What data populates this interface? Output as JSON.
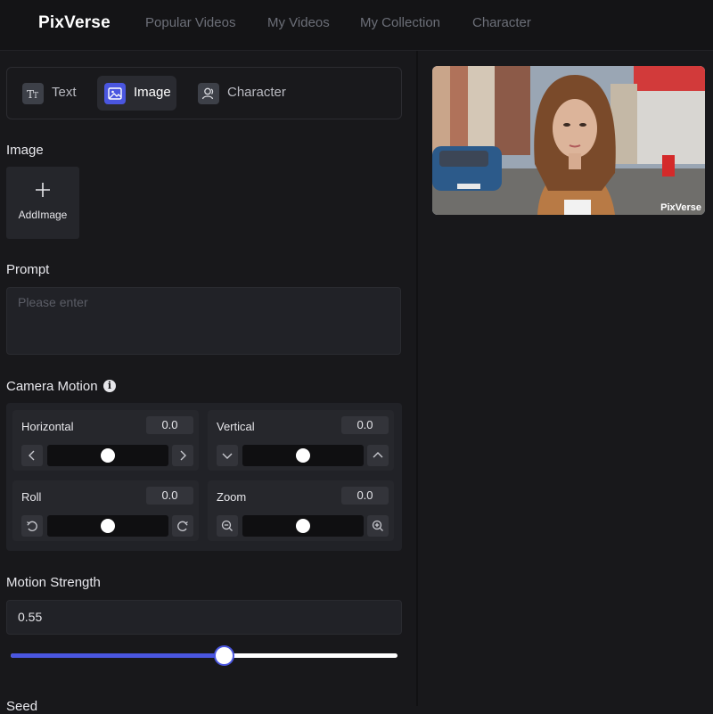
{
  "header": {
    "logo": "PixVerse",
    "nav": [
      "Popular Videos",
      "My Videos",
      "My Collection",
      "Character"
    ]
  },
  "mode_tabs": [
    {
      "label": "Text",
      "icon": "text-icon",
      "active": false
    },
    {
      "label": "Image",
      "icon": "image-icon",
      "active": true
    },
    {
      "label": "Character",
      "icon": "character-icon",
      "active": false
    }
  ],
  "image_section": {
    "label": "Image",
    "add_label": "AddImage"
  },
  "prompt": {
    "label": "Prompt",
    "placeholder": "Please enter",
    "value": ""
  },
  "camera_motion": {
    "label": "Camera Motion",
    "controls": [
      {
        "name": "Horizontal",
        "value": "0.0",
        "left_icon": "chevron-left-icon",
        "right_icon": "chevron-right-icon"
      },
      {
        "name": "Vertical",
        "value": "0.0",
        "left_icon": "chevron-down-icon",
        "right_icon": "chevron-up-icon"
      },
      {
        "name": "Roll",
        "value": "0.0",
        "left_icon": "rotate-ccw-icon",
        "right_icon": "rotate-cw-icon"
      },
      {
        "name": "Zoom",
        "value": "0.0",
        "left_icon": "zoom-out-icon",
        "right_icon": "zoom-in-icon"
      }
    ]
  },
  "motion_strength": {
    "label": "Motion Strength",
    "value": "0.55",
    "slider_fraction": 0.55
  },
  "seed": {
    "label": "Seed"
  },
  "preview": {
    "watermark": "PixVerse"
  },
  "colors": {
    "accent": "#4a56e0",
    "background": "#18181b",
    "panel": "#212227"
  }
}
